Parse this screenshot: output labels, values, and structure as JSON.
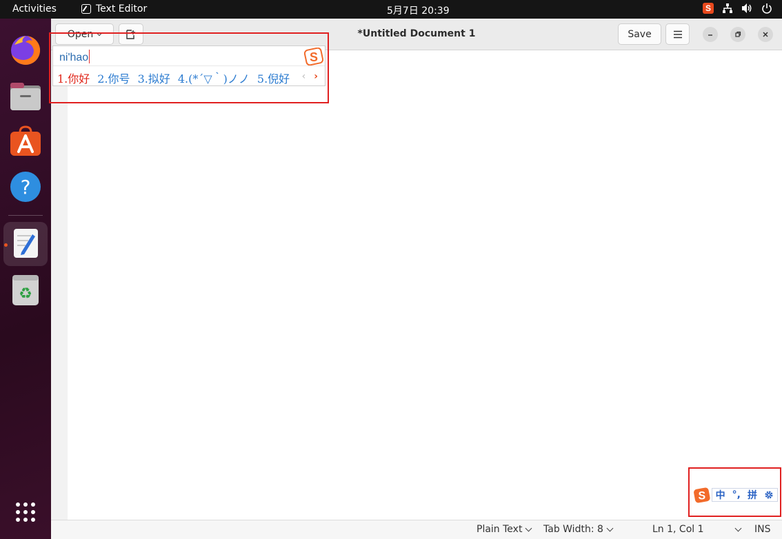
{
  "topbar": {
    "activities": "Activities",
    "app_name": "Text Editor",
    "clock": "5月7日  20:39",
    "tray_icons": [
      "sogou-icon",
      "network-icon",
      "volume-icon",
      "power-icon"
    ]
  },
  "dock": {
    "items": [
      "firefox",
      "files",
      "app-center",
      "help",
      "text-editor",
      "trash",
      "show-apps"
    ],
    "active": "text-editor"
  },
  "window": {
    "open_label": "Open",
    "title": "*Untitled Document 1",
    "save_label": "Save"
  },
  "ime": {
    "preedit": "ni'hao",
    "candidates": [
      "1.你好",
      "2.你号",
      "3.拟好",
      "4.(*´▽｀)ノノ",
      "5.倪好"
    ],
    "prev": "‹",
    "next": "›",
    "logo_letter": "S"
  },
  "ime_status": {
    "logo_letter": "S",
    "mode": "中",
    "punct": "°,",
    "input": "拼"
  },
  "statusbar": {
    "language": "Plain Text",
    "tab_width": "Tab Width: 8",
    "position": "Ln 1, Col 1",
    "insert_mode": "INS"
  },
  "colors": {
    "accent": "#e95420",
    "highlight": "#e02020",
    "candidate": "#2b7bd0",
    "candidate_first": "#e0281c"
  }
}
